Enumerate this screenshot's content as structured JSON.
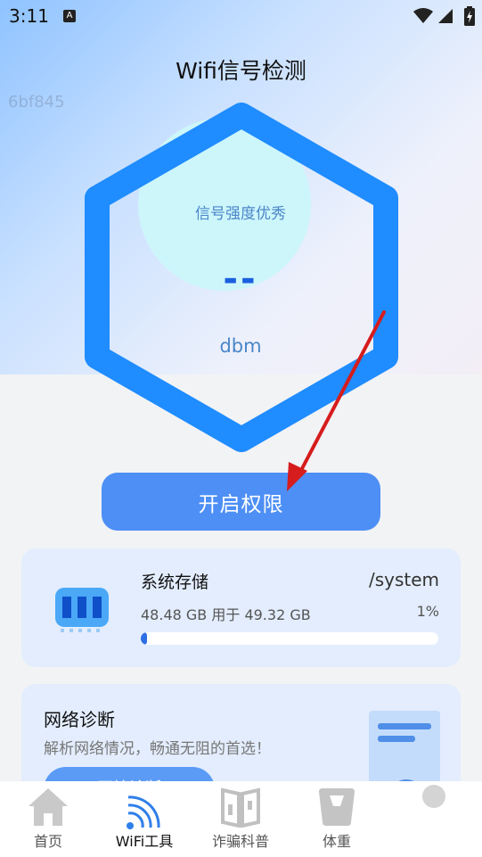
{
  "status_bar": {
    "time": "3:11",
    "notification_badge": "A"
  },
  "header": {
    "title": "Wifi信号检测",
    "device_code": "6bf845"
  },
  "gauge": {
    "quality_text": "信号强度优秀",
    "value": "--",
    "unit": "dbm"
  },
  "enable_button_label": "开启权限",
  "storage": {
    "title": "系统存储",
    "path": "/system",
    "usage_text": "48.48 GB 用于 49.32 GB",
    "percent_text": "1%",
    "progress_fraction": 0.01
  },
  "diagnosis": {
    "title": "网络诊断",
    "description": "解析网络情况，畅通无阻的首选！",
    "button_label": "开始诊断"
  },
  "bottom_nav": [
    {
      "label": "首页",
      "icon": "home-icon"
    },
    {
      "label": "WiFi工具",
      "icon": "wifi-icon"
    },
    {
      "label": "诈骗科普",
      "icon": "book-icon"
    },
    {
      "label": "体重",
      "icon": "scale-icon"
    }
  ],
  "colors": {
    "accent": "#4d8ff5",
    "hexagon": "#1f8cff",
    "card_bg": "#e3edfd",
    "annotation_arrow": "#d61c1c"
  }
}
